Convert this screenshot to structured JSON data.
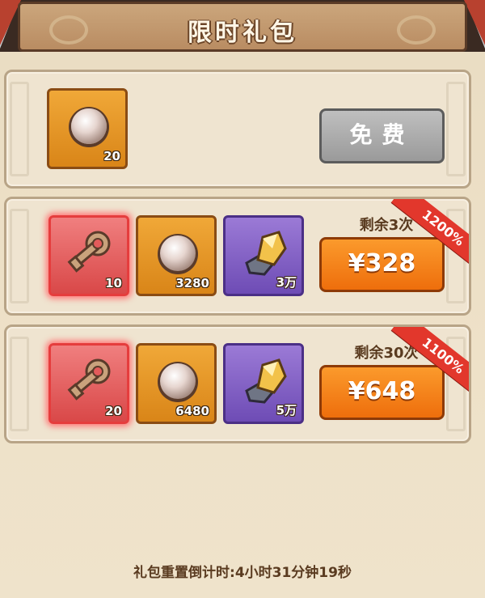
{
  "header": {
    "title": "限时礼包"
  },
  "packs": [
    {
      "items": [
        {
          "type": "pearl",
          "qty": "20"
        }
      ],
      "button": {
        "label": "免费",
        "style": "gray"
      }
    },
    {
      "items": [
        {
          "type": "key",
          "qty": "10"
        },
        {
          "type": "pearl",
          "qty": "3280"
        },
        {
          "type": "crystal",
          "qty": "3万"
        }
      ],
      "remaining": "剩余3次",
      "badge": "1200%",
      "button": {
        "label": "¥328",
        "style": "orange"
      }
    },
    {
      "items": [
        {
          "type": "key",
          "qty": "20"
        },
        {
          "type": "pearl",
          "qty": "6480"
        },
        {
          "type": "crystal",
          "qty": "5万"
        }
      ],
      "remaining": "剩余30次",
      "badge": "1100%",
      "button": {
        "label": "¥648",
        "style": "orange"
      }
    }
  ],
  "footer": {
    "countdown": "礼包重置倒计时:4小时31分钟19秒"
  },
  "colors": {
    "gold_tile": "#e8961f",
    "red_tile": "#e35b5b",
    "purple_tile": "#8563c6",
    "buy_button": "#f17a12",
    "free_button": "#a9a9a9",
    "badge": "#e2372c"
  },
  "icons": {
    "pearl": "pearl-icon",
    "key": "key-icon",
    "crystal": "crystal-ore-icon"
  }
}
